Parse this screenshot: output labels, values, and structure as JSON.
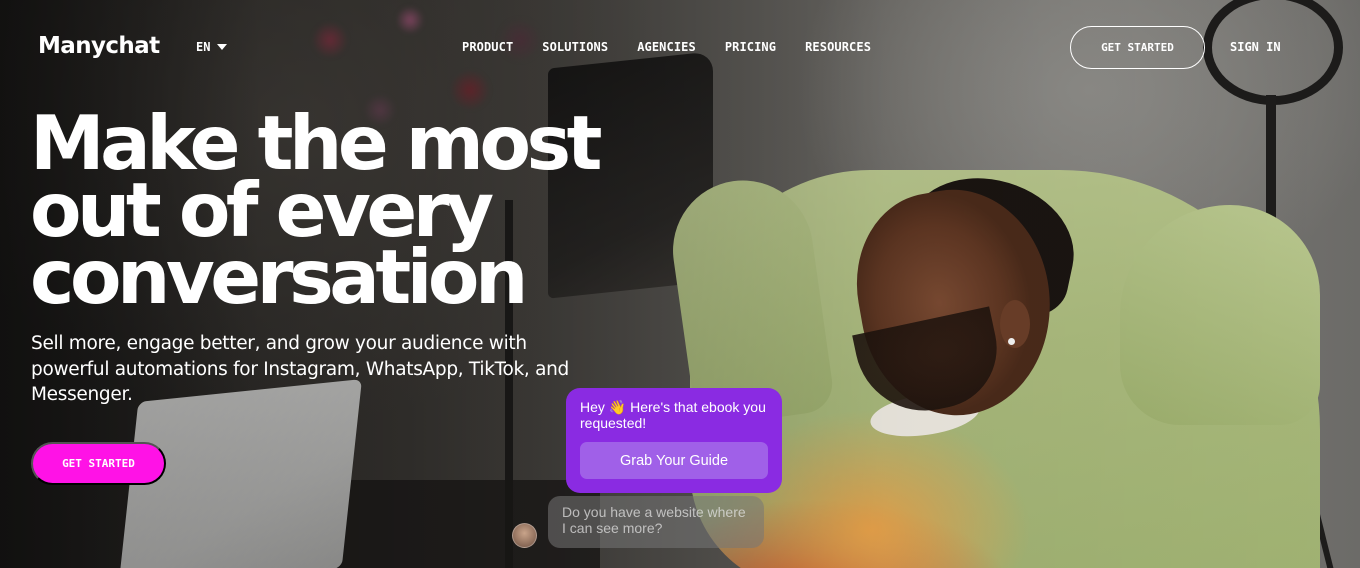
{
  "brand": {
    "logo_text": "Manychat"
  },
  "nav": {
    "language": "EN",
    "menu": [
      {
        "label": "PRODUCT"
      },
      {
        "label": "SOLUTIONS"
      },
      {
        "label": "AGENCIES"
      },
      {
        "label": "PRICING"
      },
      {
        "label": "RESOURCES"
      }
    ],
    "get_started": "GET STARTED",
    "sign_in": "SIGN IN"
  },
  "hero": {
    "title_lines": [
      "Make the most",
      "out of every",
      "conversation"
    ],
    "subtitle": "Sell more, engage better, and grow your audience with powerful automations for Instagram, WhatsApp, TikTok, and Messenger.",
    "cta": "GET STARTED"
  },
  "chat": {
    "bot_message": "Hey 👋 Here's that ebook you requested!",
    "cta": "Grab Your Guide",
    "user_reply": "Do you have a website where I can see more?"
  },
  "colors": {
    "accent_pink": "#ff12e6",
    "chat_purple": "#8a2be2",
    "chat_button": "#a060e8"
  }
}
